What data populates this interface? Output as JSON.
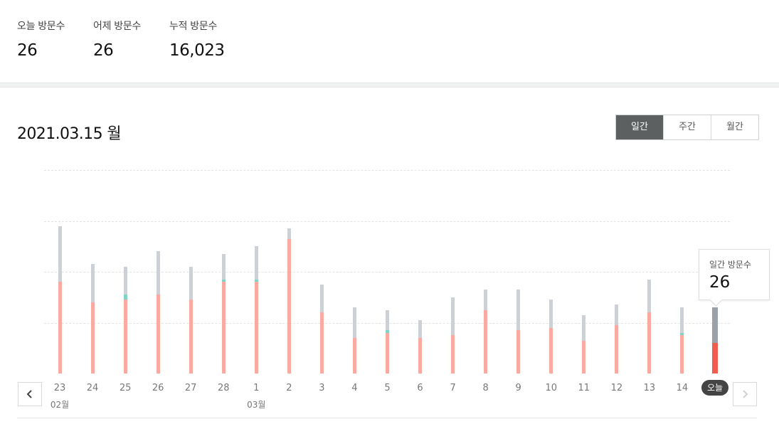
{
  "stats": [
    {
      "label": "오늘 방문수",
      "value": "26"
    },
    {
      "label": "어제 방문수",
      "value": "26"
    },
    {
      "label": "누적 방문수",
      "value": "16,023"
    }
  ],
  "date_title": "2021.03.15 월",
  "period_tabs": [
    {
      "label": "일간",
      "active": true
    },
    {
      "label": "주간",
      "active": false
    },
    {
      "label": "월간",
      "active": false
    }
  ],
  "tooltip": {
    "label": "일간 방문수",
    "value": "26"
  },
  "today_label": "오늘",
  "colors": {
    "total": "#cdd1d5",
    "new": "#fbaaa2",
    "accent": "#7fd4c6",
    "today_total": "#9aa1a9",
    "today_new": "#f25c4f"
  },
  "chart_data": {
    "type": "bar",
    "categories": [
      "23",
      "24",
      "25",
      "26",
      "27",
      "28",
      "1",
      "2",
      "3",
      "4",
      "5",
      "6",
      "7",
      "8",
      "9",
      "10",
      "11",
      "12",
      "13",
      "14",
      "오늘"
    ],
    "month_labels": [
      {
        "index": 0,
        "label": "02월"
      },
      {
        "index": 6,
        "label": "03월"
      }
    ],
    "series": [
      {
        "values": [
          58,
          43,
          42,
          48,
          42,
          47,
          50,
          57,
          35,
          26,
          25,
          21,
          30,
          33,
          33,
          29,
          23,
          27,
          37,
          26,
          26
        ]
      },
      {
        "values": [
          36,
          28,
          29,
          31,
          29,
          36,
          36,
          53,
          24,
          14,
          16,
          14,
          15,
          25,
          17,
          18,
          13,
          19,
          24,
          15,
          12
        ]
      }
    ],
    "highlight": {
      "0": [],
      "2": [
        29,
        31
      ],
      "5": [
        36,
        37
      ],
      "6": [
        36,
        37
      ],
      "10": [
        16,
        17
      ],
      "19": [
        15,
        16
      ]
    },
    "ylim": [
      0,
      80
    ],
    "grid": true
  }
}
